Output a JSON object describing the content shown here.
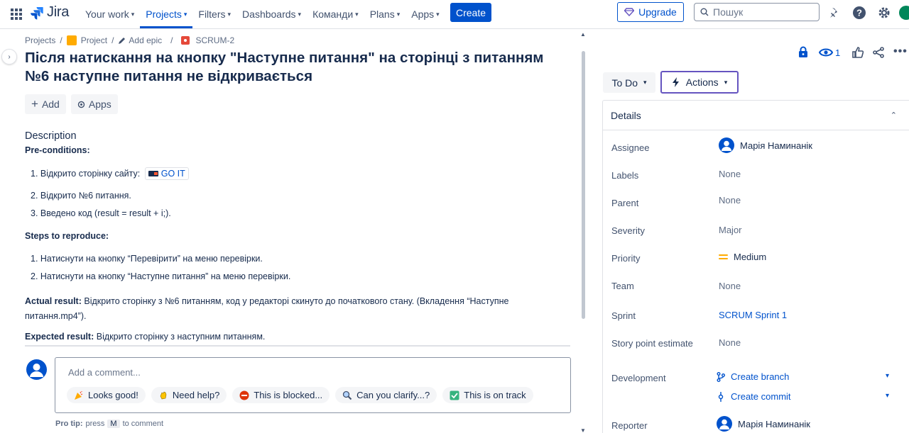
{
  "nav": {
    "logo": "Jira",
    "items": [
      {
        "label": "Your work",
        "active": false
      },
      {
        "label": "Projects",
        "active": true
      },
      {
        "label": "Filters",
        "active": false
      },
      {
        "label": "Dashboards",
        "active": false
      },
      {
        "label": "Команди",
        "active": false
      },
      {
        "label": "Plans",
        "active": false
      },
      {
        "label": "Apps",
        "active": false
      }
    ],
    "create": "Create",
    "upgrade": "Upgrade",
    "search_placeholder": "Пошук"
  },
  "breadcrumb": {
    "projects": "Projects",
    "project": "Project",
    "add_epic": "Add epic",
    "issue_key": "SCRUM-2"
  },
  "issue": {
    "title": "Після натискання на кнопку \"Наступне питання\" на сторінці з питанням №6 наступне питання не відкривається",
    "add_btn": "Add",
    "apps_btn": "Apps",
    "description_heading": "Description",
    "preconditions_heading": "Pre-conditions:",
    "preconditions": [
      "1. Відкрито сторінку сайту:",
      "2. Відкрито №6 питання.",
      "3. Введено код (result = result + i;)."
    ],
    "goit_link": "GO IT",
    "steps_heading": "Steps to reproduce:",
    "steps": [
      "1. Натиснути на кнопку “Перевірити” на меню перевірки.",
      "2. Натиснути на кнопку “Наступне питання” на меню перевірки."
    ],
    "actual_label": "Actual result:",
    "actual_text_line1": " Відкрито сторінку з №6 питанням, код у редакторі скинуто до початкового стану. (Вкладення “Наступне",
    "actual_text_line2": "питання.mp4”).",
    "expected_label": "Expected result:",
    "expected_text": " Відкрито сторінку з наступним питанням."
  },
  "comment": {
    "placeholder": "Add a comment...",
    "chips": [
      "Looks good!",
      "Need help?",
      "This is blocked...",
      "Can you clarify...?",
      "This is on track"
    ],
    "protip_label": "Pro tip:",
    "protip_press": "press",
    "protip_key": "M",
    "protip_to": "to comment"
  },
  "right": {
    "watch_count": "1",
    "status": "To Do",
    "actions": "Actions",
    "details_heading": "Details",
    "fields": {
      "assignee_label": "Assignee",
      "assignee": "Марія Наминанік",
      "labels_label": "Labels",
      "labels": "None",
      "parent_label": "Parent",
      "parent": "None",
      "severity_label": "Severity",
      "severity": "Major",
      "priority_label": "Priority",
      "priority": "Medium",
      "team_label": "Team",
      "team": "None",
      "sprint_label": "Sprint",
      "sprint": "SCRUM Sprint 1",
      "story_label": "Story point estimate",
      "story": "None",
      "development_label": "Development",
      "create_branch": "Create branch",
      "create_commit": "Create commit",
      "reporter_label": "Reporter",
      "reporter": "Марія Наминанік"
    }
  },
  "colors": {
    "brand": "#0052cc",
    "text": "#172b4d",
    "actions_border": "#6554c0",
    "priority_medium": "#ffab00"
  }
}
